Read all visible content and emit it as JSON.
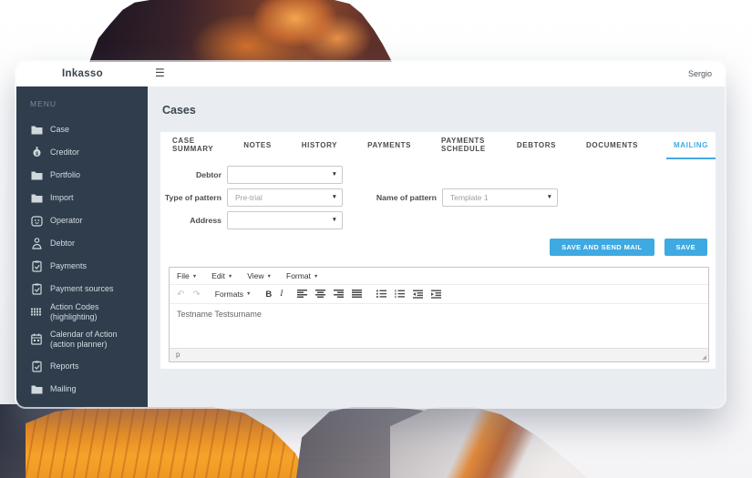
{
  "colors": {
    "accent": "#3fa9e1",
    "tab_active": "#45aae2",
    "sidebar_bg": "#2f3d4c"
  },
  "topbar": {
    "brand": "Inkasso",
    "menu_icon": "hamburger-icon",
    "user": "Sergio"
  },
  "sidebar": {
    "menu_label": "MENU",
    "items": [
      {
        "label": "Case",
        "icon": "folder-icon"
      },
      {
        "label": "Creditor",
        "icon": "money-bag-icon"
      },
      {
        "label": "Portfolio",
        "icon": "folder-icon"
      },
      {
        "label": "Import",
        "icon": "folder-icon"
      },
      {
        "label": "Operator",
        "icon": "operator-icon"
      },
      {
        "label": "Debtor",
        "icon": "person-icon"
      },
      {
        "label": "Payments",
        "icon": "clipboard-icon"
      },
      {
        "label": "Payment sources",
        "icon": "clipboard-icon"
      },
      {
        "label": "Action Codes (highlighting)",
        "icon": "grid-icon"
      },
      {
        "label": "Calendar of Action",
        "label2": "(action planner)",
        "icon": "calendar-icon"
      },
      {
        "label": "Reports",
        "icon": "clipboard-icon"
      },
      {
        "label": "Mailing",
        "icon": "folder-icon"
      }
    ]
  },
  "main": {
    "title": "Cases",
    "tabs": [
      {
        "label": "CASE SUMMARY",
        "active": false
      },
      {
        "label": "NOTES",
        "active": false
      },
      {
        "label": "HISTORY",
        "active": false
      },
      {
        "label": "PAYMENTS",
        "active": false
      },
      {
        "label": "PAYMENTS SCHEDULE",
        "active": false
      },
      {
        "label": "DEBTORS",
        "active": false
      },
      {
        "label": "DOCUMENTS",
        "active": false
      },
      {
        "label": "MAILING",
        "active": true
      }
    ],
    "form": {
      "fields": [
        {
          "label": "Debtor",
          "value": ""
        },
        {
          "label": "Type of pattern",
          "value": "Pre-trial"
        },
        {
          "label": "Name of pattern",
          "value": "Template 1"
        },
        {
          "label": "Address",
          "value": ""
        }
      ]
    },
    "buttons": {
      "save_send": "SAVE AND SEND MAIL",
      "save": "SAVE"
    },
    "editor": {
      "menus": [
        "File",
        "Edit",
        "View",
        "Format"
      ],
      "formats_label": "Formats",
      "bold_label": "B",
      "italic_label": "I",
      "toolbar_groups": [
        [
          "undo-icon",
          "redo-icon"
        ],
        [
          "formats-dropdown"
        ],
        [
          "bold-icon",
          "italic-icon"
        ],
        [
          "align-left-icon",
          "align-center-icon",
          "align-right-icon",
          "align-justify-icon"
        ],
        [
          "bullet-list-icon",
          "numbered-list-icon",
          "outdent-icon",
          "indent-icon"
        ]
      ],
      "content": "Testname Testsurname",
      "status_path": "p"
    }
  }
}
